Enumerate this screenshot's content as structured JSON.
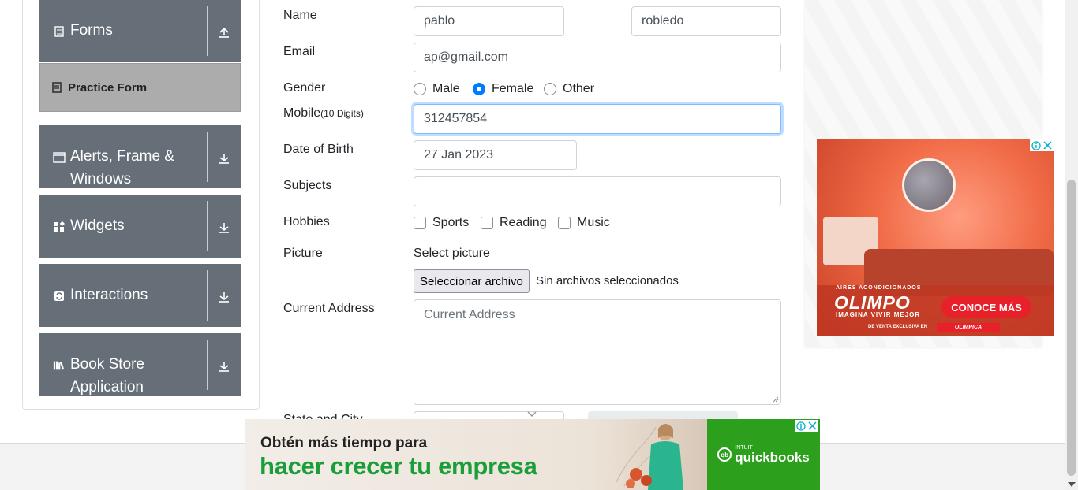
{
  "sidebar": {
    "groups": [
      {
        "title": "Forms",
        "icon": "document-icon",
        "arrow": "collapse-arrow-icon"
      },
      {
        "title": "Alerts, Frame & Windows",
        "icon": "window-icon",
        "arrow": "expand-arrow-icon"
      },
      {
        "title": "Widgets",
        "icon": "widgets-icon",
        "arrow": "expand-arrow-icon"
      },
      {
        "title": "Interactions",
        "icon": "interactions-icon",
        "arrow": "expand-arrow-icon"
      },
      {
        "title": "Book Store Application",
        "icon": "books-icon",
        "arrow": "expand-arrow-icon"
      }
    ],
    "active_item": {
      "label": "Practice Form",
      "icon": "form-icon"
    }
  },
  "form": {
    "name_label": "Name",
    "first_name_value": "pablo",
    "last_name_value": "robledo",
    "email_label": "Email",
    "email_value": "ap@gmail.com",
    "gender_label": "Gender",
    "gender_options": [
      "Male",
      "Female",
      "Other"
    ],
    "gender_selected": "Female",
    "mobile_label": "Mobile",
    "mobile_hint": "(10 Digits)",
    "mobile_value": "312457854",
    "dob_label": "Date of Birth",
    "dob_value": "27 Jan 2023",
    "subjects_label": "Subjects",
    "subjects_value": "",
    "hobbies_label": "Hobbies",
    "hobbies_options": [
      "Sports",
      "Reading",
      "Music"
    ],
    "picture_label": "Picture",
    "picture_prompt": "Select picture",
    "file_button_label": "Seleccionar archivo",
    "file_status": "Sin archivos seleccionados",
    "address_label": "Current Address",
    "address_placeholder": "Current Address",
    "state_city_label": "State and City"
  },
  "ads": {
    "right": {
      "kicker": "AIRES ACONDICIONADOS",
      "brand": "OLIMPO",
      "tagline": "IMAGINA VIVIR MEJOR",
      "cta": "CONOCE MÁS",
      "exclusive": "DE VENTA EXCLUSIVA EN",
      "exclusive_brand": "OLIMPICA"
    },
    "bottom": {
      "line1": "Obtén más tiempo para",
      "line2": "hacer crecer tu empresa",
      "logo_small": "INTUIT",
      "logo_name": "quickbooks",
      "logo_badge": "qb"
    }
  },
  "colors": {
    "sidebar_header_bg": "#666f78",
    "active_item_bg": "#acacac",
    "radio_checked": "#007bff",
    "focus_border": "#80bdff",
    "quickbooks_green": "#2ca01c",
    "cta_red": "#e8202a"
  }
}
